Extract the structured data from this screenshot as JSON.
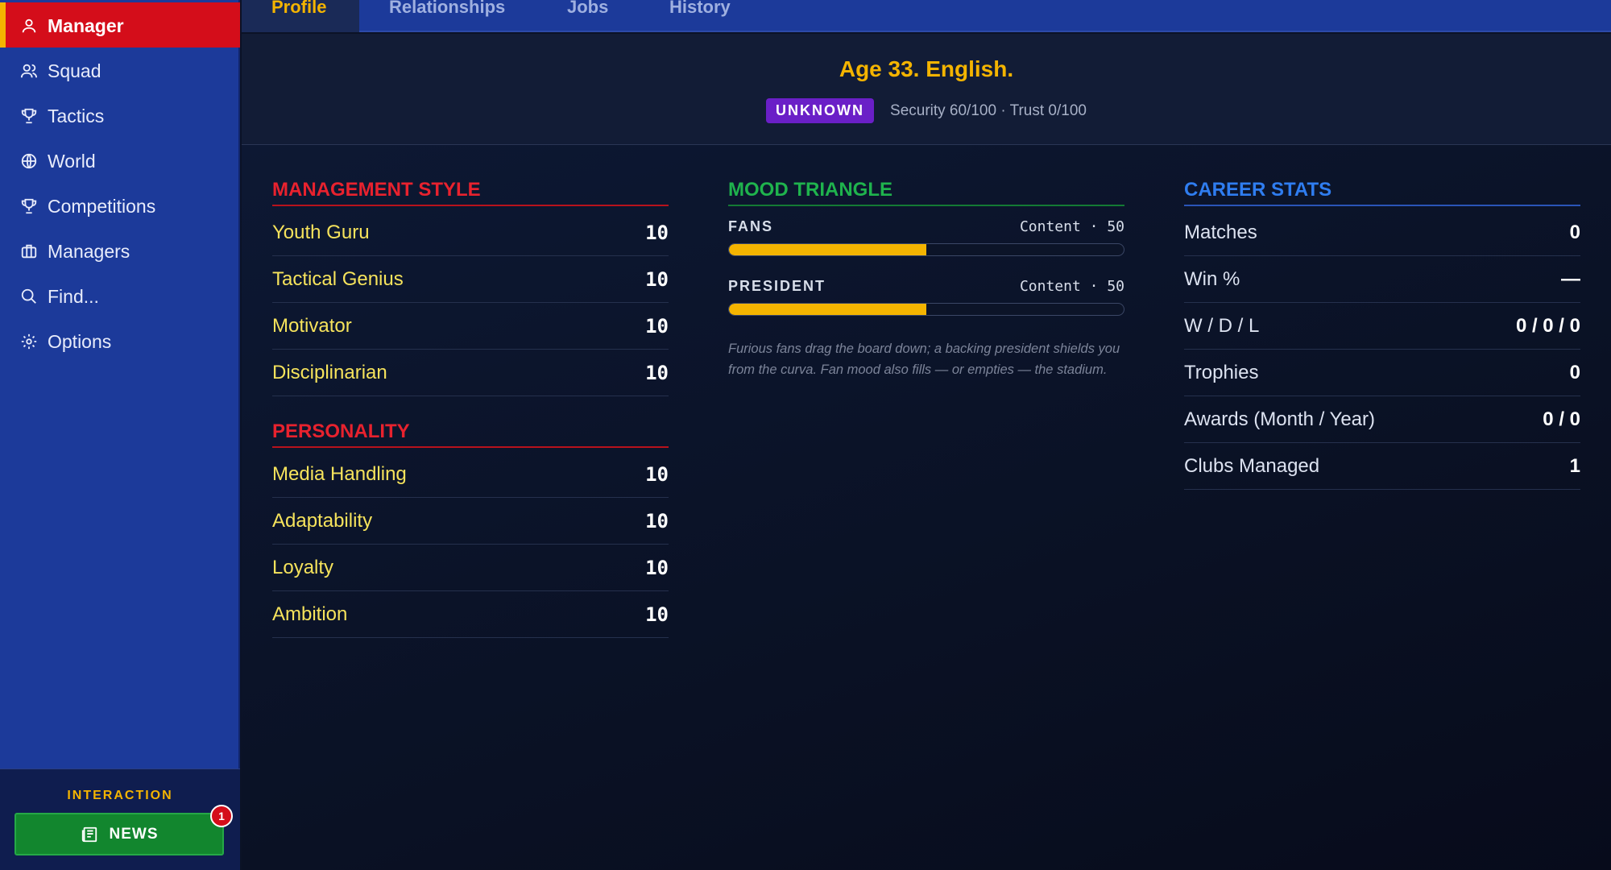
{
  "sidebar": {
    "items": [
      {
        "label": "Manager",
        "icon": "person-icon",
        "active": true
      },
      {
        "label": "Squad",
        "icon": "people-icon"
      },
      {
        "label": "Tactics",
        "icon": "trophy-icon"
      },
      {
        "label": "World",
        "icon": "globe-icon"
      },
      {
        "label": "Competitions",
        "icon": "trophy-icon"
      },
      {
        "label": "Managers",
        "icon": "briefcase-icon"
      },
      {
        "label": "Find...",
        "icon": "search-icon"
      },
      {
        "label": "Options",
        "icon": "gear-icon"
      }
    ],
    "interaction_label": "INTERACTION",
    "news_label": "NEWS",
    "news_badge": "1"
  },
  "tabs": [
    "Profile",
    "Relationships",
    "Jobs",
    "History"
  ],
  "header": {
    "headline": "Age 33. English.",
    "status_badge": "UNKNOWN",
    "status_text": "Security 60/100 · Trust 0/100"
  },
  "management_style": {
    "title": "MANAGEMENT STYLE",
    "rows": [
      {
        "label": "Youth Guru",
        "value": "10"
      },
      {
        "label": "Tactical Genius",
        "value": "10"
      },
      {
        "label": "Motivator",
        "value": "10"
      },
      {
        "label": "Disciplinarian",
        "value": "10"
      }
    ]
  },
  "personality": {
    "title": "PERSONALITY",
    "rows": [
      {
        "label": "Media Handling",
        "value": "10"
      },
      {
        "label": "Adaptability",
        "value": "10"
      },
      {
        "label": "Loyalty",
        "value": "10"
      },
      {
        "label": "Ambition",
        "value": "10"
      }
    ]
  },
  "mood": {
    "title": "MOOD TRIANGLE",
    "items": [
      {
        "name": "FANS",
        "status": "Content · 50",
        "level_percent": 50
      },
      {
        "name": "PRESIDENT",
        "status": "Content · 50",
        "level_percent": 50
      }
    ],
    "note": "Furious fans drag the board down; a backing president shields you from the curva. Fan mood also fills — or empties — the stadium."
  },
  "career_stats": {
    "title": "CAREER STATS",
    "rows": [
      {
        "label": "Matches",
        "value": "0"
      },
      {
        "label": "Win %",
        "value": "—"
      },
      {
        "label": "W / D / L",
        "value": "0 / 0 / 0"
      },
      {
        "label": "Trophies",
        "value": "0"
      },
      {
        "label": "Awards (Month / Year)",
        "value": "0 / 0"
      },
      {
        "label": "Clubs Managed",
        "value": "1"
      }
    ]
  },
  "colors": {
    "sidebar_bg": "#1c3a9a",
    "active_red": "#d40d1a",
    "accent_yellow": "#f4b400",
    "news_green": "#12862e",
    "badge_purple": "#6a1fc7"
  }
}
